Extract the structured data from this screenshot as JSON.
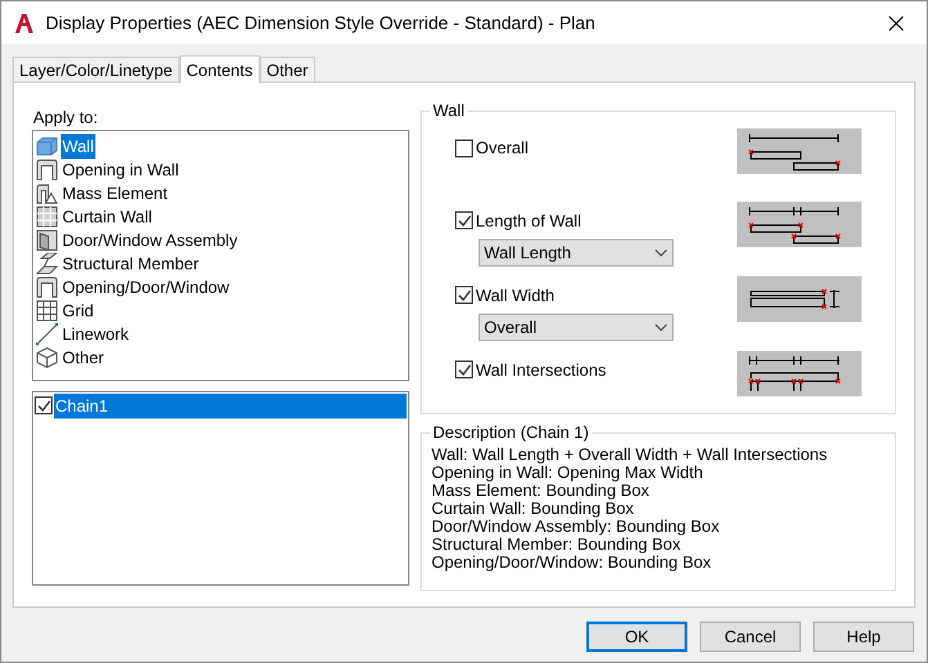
{
  "window": {
    "title": "Display Properties (AEC Dimension Style Override - Standard) - Plan"
  },
  "tabs": [
    {
      "label": "Layer/Color/Linetype",
      "selected": false
    },
    {
      "label": "Contents",
      "selected": true
    },
    {
      "label": "Other",
      "selected": false
    }
  ],
  "apply_to": {
    "label": "Apply to:",
    "items": [
      {
        "label": "Wall",
        "kind": "wall",
        "selected": true
      },
      {
        "label": "Opening in Wall",
        "kind": "opening",
        "selected": false
      },
      {
        "label": "Mass Element",
        "kind": "mass",
        "selected": false
      },
      {
        "label": "Curtain Wall",
        "kind": "curtain",
        "selected": false
      },
      {
        "label": "Door/Window Assembly",
        "kind": "door",
        "selected": false
      },
      {
        "label": "Structural Member",
        "kind": "structural",
        "selected": false
      },
      {
        "label": "Opening/Door/Window",
        "kind": "opening",
        "selected": false
      },
      {
        "label": "Grid",
        "kind": "grid",
        "selected": false
      },
      {
        "label": "Linework",
        "kind": "linework",
        "selected": false
      },
      {
        "label": "Other",
        "kind": "other",
        "selected": false
      }
    ]
  },
  "chains": [
    {
      "label": "Chain1",
      "checked": true,
      "selected": true
    }
  ],
  "wall_group": {
    "title": "Wall",
    "options": [
      {
        "label": "Overall",
        "checked": false,
        "kind": "overall"
      },
      {
        "label": "Length of Wall",
        "checked": true,
        "dropdown": "Wall Length",
        "kind": "length"
      },
      {
        "label": "Wall Width",
        "checked": true,
        "dropdown": "Overall",
        "kind": "width"
      },
      {
        "label": "Wall Intersections",
        "checked": true,
        "kind": "intersections"
      }
    ]
  },
  "description": {
    "title": "Description (Chain 1)",
    "lines": [
      "Wall: Wall Length + Overall Width + Wall Intersections",
      "Opening in Wall: Opening Max Width",
      "Mass Element: Bounding Box",
      "Curtain Wall: Bounding Box",
      "Door/Window Assembly: Bounding Box",
      "Structural Member: Bounding Box",
      "Opening/Door/Window: Bounding Box"
    ]
  },
  "buttons": [
    {
      "label": "OK",
      "default": true
    },
    {
      "label": "Cancel",
      "default": false
    },
    {
      "label": "Help",
      "default": false
    }
  ]
}
